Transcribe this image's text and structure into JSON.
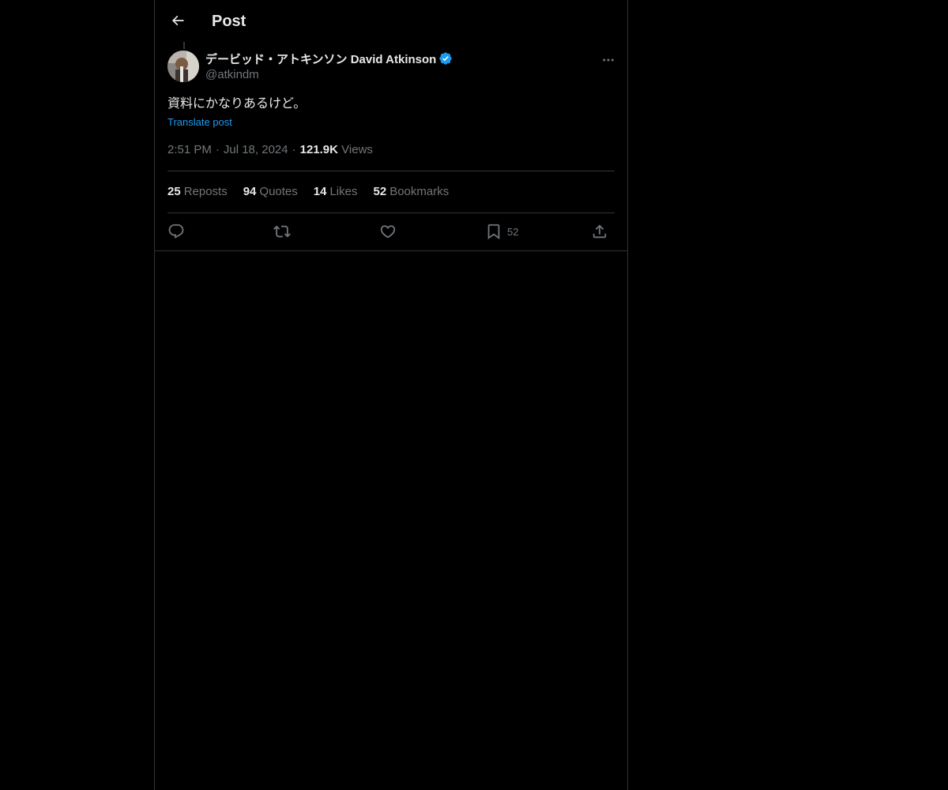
{
  "header": {
    "title": "Post",
    "back_icon": "arrow-left-icon"
  },
  "post": {
    "author": {
      "display_name": "デービッド・アトキンソン David Atkinson",
      "handle": "@atkindm",
      "verified": true
    },
    "text": "資料にかなりあるけど。",
    "translate_label": "Translate post",
    "time": "2:51 PM",
    "date": "Jul 18, 2024",
    "views_count": "121.9K",
    "views_label": "Views",
    "stats": [
      {
        "count": "25",
        "label": "Reposts"
      },
      {
        "count": "94",
        "label": "Quotes"
      },
      {
        "count": "14",
        "label": "Likes"
      },
      {
        "count": "52",
        "label": "Bookmarks"
      }
    ],
    "actions": {
      "reply_icon": "reply-icon",
      "repost_icon": "repost-icon",
      "like_icon": "heart-icon",
      "bookmark_icon": "bookmark-icon",
      "bookmark_count": "52",
      "share_icon": "share-icon"
    }
  },
  "colors": {
    "background": "#000000",
    "text": "#e7e9ea",
    "muted": "#71767b",
    "accent": "#1d9bf0",
    "border": "#2f3336"
  }
}
